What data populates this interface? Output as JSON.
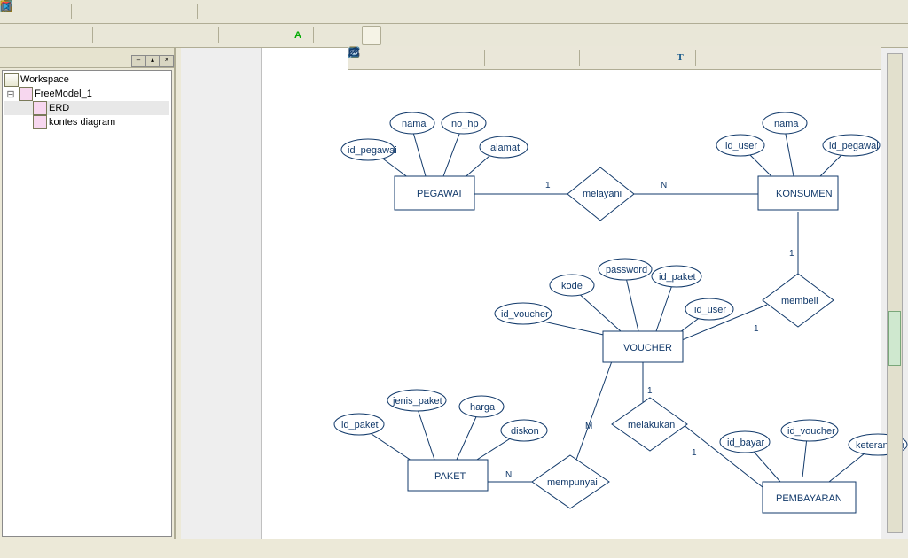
{
  "tree": {
    "root": "Workspace",
    "model": "FreeModel_1",
    "items": [
      "ERD",
      "kontes diagram"
    ],
    "selected": 0
  },
  "erd": {
    "entities": {
      "pegawai": "PEGAWAI",
      "konsumen": "KONSUMEN",
      "voucher": "VOUCHER",
      "paket": "PAKET",
      "pembayaran": "PEMBAYARAN"
    },
    "relationships": {
      "melayani": "melayani",
      "membeli": "membeli",
      "melakukan": "melakukan",
      "mempunyai": "mempunyai"
    },
    "attributes": {
      "pegawai": [
        "id_pegawai",
        "nama",
        "no_hp",
        "alamat"
      ],
      "konsumen": [
        "id_user",
        "nama",
        "id_pegawai"
      ],
      "voucher": [
        "id_voucher",
        "kode",
        "password",
        "id_paket",
        "id_user"
      ],
      "paket": [
        "id_paket",
        "jenis_paket",
        "harga",
        "diskon"
      ],
      "pembayaran": [
        "id_bayar",
        "id_voucher",
        "keterangan"
      ]
    },
    "card": {
      "melayani_l": "1",
      "melayani_r": "N",
      "membeli_t": "1",
      "membeli_b": "1",
      "melakukan_t": "1",
      "melakukan_b": "1",
      "mempunyai_l": "N",
      "mempunyai_r": "M"
    }
  }
}
